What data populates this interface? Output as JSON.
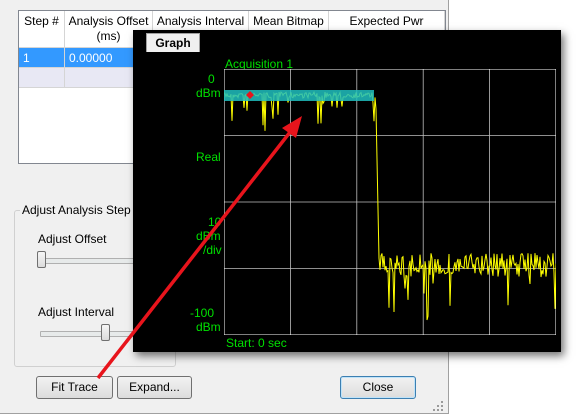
{
  "table": {
    "columns": [
      "Step #",
      "Analysis Offset (ms)",
      "Analysis Interval",
      "Mean Bitmap",
      "Expected Pwr"
    ],
    "rows": [
      {
        "step": "1",
        "offset": "0.00000"
      }
    ]
  },
  "adjust": {
    "group_title": "Adjust Analysis Step",
    "offset_label": "Adjust Offset",
    "interval_label": "Adjust Interval"
  },
  "buttons": {
    "fit_trace": "Fit Trace",
    "expand": "Expand...",
    "close": "Close"
  },
  "graph": {
    "tab_label": "Graph",
    "acquisition_label": "Acquisition 1",
    "y_top_value": "0",
    "y_top_unit": "dBm",
    "y_mode": "Real",
    "y_scale_value": "10",
    "y_scale_unit1": "dBm",
    "y_scale_unit2": "/div",
    "y_bottom_value": "-100",
    "y_bottom_unit": "dBm",
    "x_start": "Start: 0  sec",
    "colors": {
      "trace": "#ffff00",
      "highlight": "#20c0c0",
      "labels": "#00e000",
      "grid": "#ffffff",
      "arrow": "#e8141c"
    }
  }
}
